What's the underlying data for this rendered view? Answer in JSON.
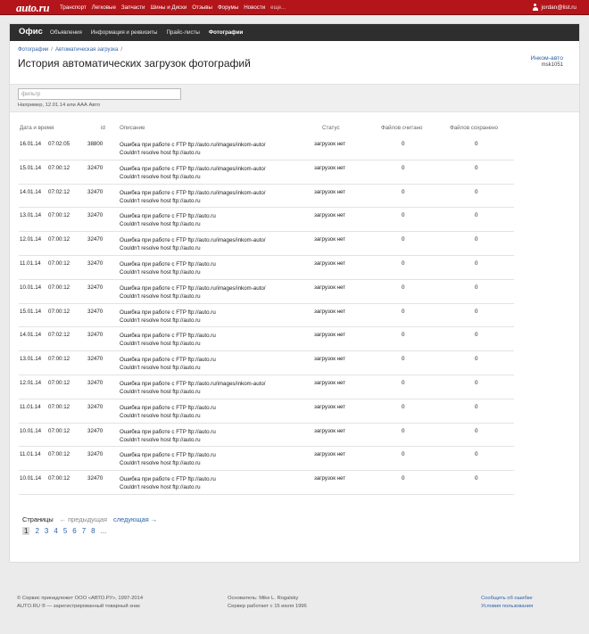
{
  "topbar": {
    "logo": "auto.ru",
    "nav": [
      "Транспорт",
      "Легковые",
      "Запчасти",
      "Шины и Диски",
      "Отзывы",
      "Форумы",
      "Новости",
      "еще..."
    ],
    "user": "jordan@list.ru"
  },
  "office": {
    "title": "Офис",
    "tabs": [
      "Объявления",
      "Информация и реквизиты",
      "Прайс-листы",
      "Фотографии"
    ],
    "active_tab": "Фотографии"
  },
  "breadcrumb": [
    "Фотографии",
    "Автоматическая загрузка"
  ],
  "page_title": "История автоматических загрузок фотографий",
  "company": {
    "name": "Инком-авто",
    "code": "msk1051"
  },
  "filter": {
    "placeholder": "фильтр",
    "hint": "Например, 12.01.14 или ААА Авто"
  },
  "table": {
    "headers": {
      "date": "Дата и время",
      "id": "id",
      "desc": "Описание",
      "status": "Статус",
      "read": "Файлов считано",
      "saved": "Файлов сохранено"
    },
    "rows": [
      {
        "date": "16.01.14",
        "time": "07:02:05",
        "id": "38800",
        "desc1": "Ошибка при работе с FTP ftp://auto.ru/images/inkom-auto/",
        "desc2": "Couldn't resolve host ftp://auto.ru",
        "status": "загрузок нет",
        "read": "0",
        "saved": "0"
      },
      {
        "date": "15.01.14",
        "time": "07:00:12",
        "id": "32470",
        "desc1": "Ошибка при работе с FTP ftp://auto.ru/images/inkom-auto/",
        "desc2": "Couldn't resolve host ftp://auto.ru",
        "status": "загрузок нет",
        "read": "0",
        "saved": "0"
      },
      {
        "date": "14.01.14",
        "time": "07:02:12",
        "id": "32470",
        "desc1": "Ошибка при работе с FTP ftp://auto.ru/images/inkom-auto/",
        "desc2": "Couldn't resolve host ftp://auto.ru",
        "status": "загрузок нет",
        "read": "0",
        "saved": "0"
      },
      {
        "date": "13.01.14",
        "time": "07:00:12",
        "id": "32470",
        "desc1": "Ошибка при работе с FTP ftp://auto.ru",
        "desc2": "Couldn't resolve host ftp://auto.ru",
        "status": "загрузок нет",
        "read": "0",
        "saved": "0"
      },
      {
        "date": "12.01.14",
        "time": "07:00:12",
        "id": "32470",
        "desc1": "Ошибка при работе с FTP ftp://auto.ru/images/inkom-auto/",
        "desc2": "Couldn't resolve host ftp://auto.ru",
        "status": "загрузок нет",
        "read": "0",
        "saved": "0"
      },
      {
        "date": "11.01.14",
        "time": "07:00:12",
        "id": "32470",
        "desc1": "Ошибка при работе с FTP ftp://auto.ru",
        "desc2": "Couldn't resolve host ftp://auto.ru",
        "status": "загрузок нет",
        "read": "0",
        "saved": "0"
      },
      {
        "date": "10.01.14",
        "time": "07:00:12",
        "id": "32470",
        "desc1": "Ошибка при работе с FTP ftp://auto.ru/images/inkom-auto/",
        "desc2": "Couldn't resolve host ftp://auto.ru",
        "status": "загрузок нет",
        "read": "0",
        "saved": "0"
      },
      {
        "date": "15.01.14",
        "time": "07:00:12",
        "id": "32470",
        "desc1": "Ошибка при работе с FTP ftp://auto.ru",
        "desc2": "Couldn't resolve host ftp://auto.ru",
        "status": "загрузок нет",
        "read": "0",
        "saved": "0"
      },
      {
        "date": "14.01.14",
        "time": "07:02:12",
        "id": "32470",
        "desc1": "Ошибка при работе с FTP ftp://auto.ru",
        "desc2": "Couldn't resolve host ftp://auto.ru",
        "status": "загрузок нет",
        "read": "0",
        "saved": "0"
      },
      {
        "date": "13.01.14",
        "time": "07:00:12",
        "id": "32470",
        "desc1": "Ошибка при работе с FTP ftp://auto.ru",
        "desc2": "Couldn't resolve host ftp://auto.ru",
        "status": "загрузок нет",
        "read": "0",
        "saved": "0"
      },
      {
        "date": "12.01.14",
        "time": "07:00:12",
        "id": "32470",
        "desc1": "Ошибка при работе с FTP ftp://auto.ru/images/inkom-auto/",
        "desc2": "Couldn't resolve host ftp://auto.ru",
        "status": "загрузок нет",
        "read": "0",
        "saved": "0"
      },
      {
        "date": "11.01.14",
        "time": "07:00:12",
        "id": "32470",
        "desc1": "Ошибка при работе с FTP ftp://auto.ru",
        "desc2": "Couldn't resolve host ftp://auto.ru",
        "status": "загрузок нет",
        "read": "0",
        "saved": "0"
      },
      {
        "date": "10.01.14",
        "time": "07:00:12",
        "id": "32470",
        "desc1": "Ошибка при работе с FTP ftp://auto.ru",
        "desc2": "Couldn't resolve host ftp://auto.ru",
        "status": "загрузок нет",
        "read": "0",
        "saved": "0"
      },
      {
        "date": "11.01.14",
        "time": "07:00:12",
        "id": "32470",
        "desc1": "Ошибка при работе с FTP ftp://auto.ru",
        "desc2": "Couldn't resolve host ftp://auto.ru",
        "status": "загрузок нет",
        "read": "0",
        "saved": "0"
      },
      {
        "date": "10.01.14",
        "time": "07:00:12",
        "id": "32470",
        "desc1": "Ошибка при работе с FTP ftp://auto.ru",
        "desc2": "Couldn't resolve host ftp://auto.ru",
        "status": "загрузок нет",
        "read": "0",
        "saved": "0"
      }
    ]
  },
  "pager": {
    "label": "Страницы",
    "prev": "← предыдущая",
    "next": "следующая →",
    "pages": [
      "1",
      "2",
      "3",
      "4",
      "5",
      "6",
      "7",
      "8",
      "..."
    ],
    "current": "1"
  },
  "footer": {
    "left1": "© Сервис принадлежит ООО «АВТО.РУ», 1997-2014",
    "left2": "AUTO.RU ® — зарегистрированный товарный знак",
    "mid1": "Основатель: Mike L. Rogalsky",
    "mid2": "Сервер работает с 15 июля 1996",
    "right1": "Сообщить об ошибке",
    "right2": "Условия пользования"
  },
  "colors": {
    "brand_red": "#b3151b",
    "office_bar": "#2e2e2e",
    "link": "#2e62a8"
  }
}
